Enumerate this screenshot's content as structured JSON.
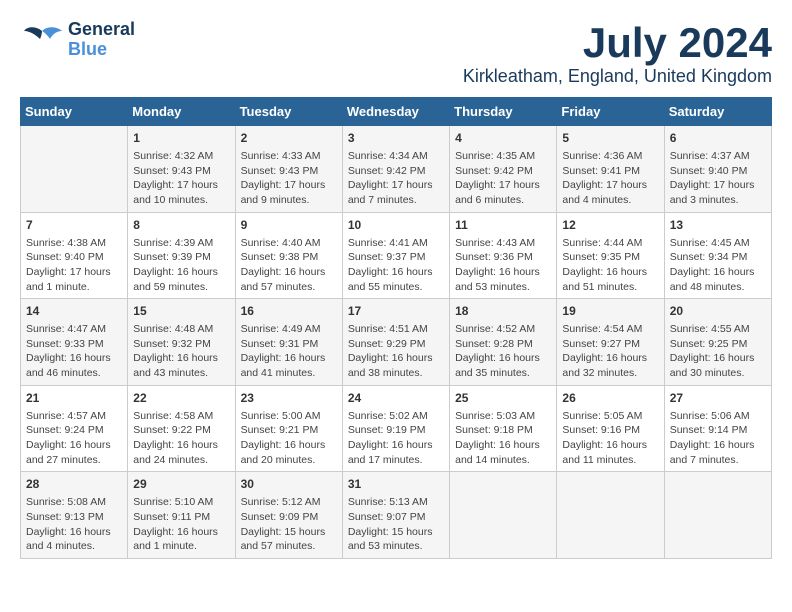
{
  "header": {
    "logo_line1": "General",
    "logo_line2": "Blue",
    "month": "July 2024",
    "location": "Kirkleatham, England, United Kingdom"
  },
  "weekdays": [
    "Sunday",
    "Monday",
    "Tuesday",
    "Wednesday",
    "Thursday",
    "Friday",
    "Saturday"
  ],
  "weeks": [
    [
      {
        "date": "",
        "content": ""
      },
      {
        "date": "1",
        "content": "Sunrise: 4:32 AM\nSunset: 9:43 PM\nDaylight: 17 hours\nand 10 minutes."
      },
      {
        "date": "2",
        "content": "Sunrise: 4:33 AM\nSunset: 9:43 PM\nDaylight: 17 hours\nand 9 minutes."
      },
      {
        "date": "3",
        "content": "Sunrise: 4:34 AM\nSunset: 9:42 PM\nDaylight: 17 hours\nand 7 minutes."
      },
      {
        "date": "4",
        "content": "Sunrise: 4:35 AM\nSunset: 9:42 PM\nDaylight: 17 hours\nand 6 minutes."
      },
      {
        "date": "5",
        "content": "Sunrise: 4:36 AM\nSunset: 9:41 PM\nDaylight: 17 hours\nand 4 minutes."
      },
      {
        "date": "6",
        "content": "Sunrise: 4:37 AM\nSunset: 9:40 PM\nDaylight: 17 hours\nand 3 minutes."
      }
    ],
    [
      {
        "date": "7",
        "content": "Sunrise: 4:38 AM\nSunset: 9:40 PM\nDaylight: 17 hours\nand 1 minute."
      },
      {
        "date": "8",
        "content": "Sunrise: 4:39 AM\nSunset: 9:39 PM\nDaylight: 16 hours\nand 59 minutes."
      },
      {
        "date": "9",
        "content": "Sunrise: 4:40 AM\nSunset: 9:38 PM\nDaylight: 16 hours\nand 57 minutes."
      },
      {
        "date": "10",
        "content": "Sunrise: 4:41 AM\nSunset: 9:37 PM\nDaylight: 16 hours\nand 55 minutes."
      },
      {
        "date": "11",
        "content": "Sunrise: 4:43 AM\nSunset: 9:36 PM\nDaylight: 16 hours\nand 53 minutes."
      },
      {
        "date": "12",
        "content": "Sunrise: 4:44 AM\nSunset: 9:35 PM\nDaylight: 16 hours\nand 51 minutes."
      },
      {
        "date": "13",
        "content": "Sunrise: 4:45 AM\nSunset: 9:34 PM\nDaylight: 16 hours\nand 48 minutes."
      }
    ],
    [
      {
        "date": "14",
        "content": "Sunrise: 4:47 AM\nSunset: 9:33 PM\nDaylight: 16 hours\nand 46 minutes."
      },
      {
        "date": "15",
        "content": "Sunrise: 4:48 AM\nSunset: 9:32 PM\nDaylight: 16 hours\nand 43 minutes."
      },
      {
        "date": "16",
        "content": "Sunrise: 4:49 AM\nSunset: 9:31 PM\nDaylight: 16 hours\nand 41 minutes."
      },
      {
        "date": "17",
        "content": "Sunrise: 4:51 AM\nSunset: 9:29 PM\nDaylight: 16 hours\nand 38 minutes."
      },
      {
        "date": "18",
        "content": "Sunrise: 4:52 AM\nSunset: 9:28 PM\nDaylight: 16 hours\nand 35 minutes."
      },
      {
        "date": "19",
        "content": "Sunrise: 4:54 AM\nSunset: 9:27 PM\nDaylight: 16 hours\nand 32 minutes."
      },
      {
        "date": "20",
        "content": "Sunrise: 4:55 AM\nSunset: 9:25 PM\nDaylight: 16 hours\nand 30 minutes."
      }
    ],
    [
      {
        "date": "21",
        "content": "Sunrise: 4:57 AM\nSunset: 9:24 PM\nDaylight: 16 hours\nand 27 minutes."
      },
      {
        "date": "22",
        "content": "Sunrise: 4:58 AM\nSunset: 9:22 PM\nDaylight: 16 hours\nand 24 minutes."
      },
      {
        "date": "23",
        "content": "Sunrise: 5:00 AM\nSunset: 9:21 PM\nDaylight: 16 hours\nand 20 minutes."
      },
      {
        "date": "24",
        "content": "Sunrise: 5:02 AM\nSunset: 9:19 PM\nDaylight: 16 hours\nand 17 minutes."
      },
      {
        "date": "25",
        "content": "Sunrise: 5:03 AM\nSunset: 9:18 PM\nDaylight: 16 hours\nand 14 minutes."
      },
      {
        "date": "26",
        "content": "Sunrise: 5:05 AM\nSunset: 9:16 PM\nDaylight: 16 hours\nand 11 minutes."
      },
      {
        "date": "27",
        "content": "Sunrise: 5:06 AM\nSunset: 9:14 PM\nDaylight: 16 hours\nand 7 minutes."
      }
    ],
    [
      {
        "date": "28",
        "content": "Sunrise: 5:08 AM\nSunset: 9:13 PM\nDaylight: 16 hours\nand 4 minutes."
      },
      {
        "date": "29",
        "content": "Sunrise: 5:10 AM\nSunset: 9:11 PM\nDaylight: 16 hours\nand 1 minute."
      },
      {
        "date": "30",
        "content": "Sunrise: 5:12 AM\nSunset: 9:09 PM\nDaylight: 15 hours\nand 57 minutes."
      },
      {
        "date": "31",
        "content": "Sunrise: 5:13 AM\nSunset: 9:07 PM\nDaylight: 15 hours\nand 53 minutes."
      },
      {
        "date": "",
        "content": ""
      },
      {
        "date": "",
        "content": ""
      },
      {
        "date": "",
        "content": ""
      }
    ]
  ]
}
